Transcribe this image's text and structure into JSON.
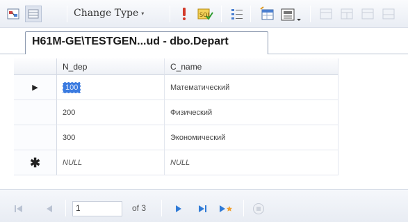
{
  "toolbar": {
    "change_type_label": "Change Type",
    "change_type_arrow": "▾"
  },
  "tab": {
    "title": "H61M-GE\\TESTGEN...ud - dbo.Depart"
  },
  "grid": {
    "columns": [
      "N_dep",
      "C_name"
    ],
    "rows": [
      {
        "marker": "▶",
        "n_dep": "100",
        "c_name": "Математический",
        "selected_cell": "n_dep"
      },
      {
        "marker": "",
        "n_dep": "200",
        "c_name": "Физический"
      },
      {
        "marker": "",
        "n_dep": "300",
        "c_name": "Экономический"
      }
    ],
    "new_row": {
      "marker": "✱",
      "n_dep": "NULL",
      "c_name": "NULL"
    }
  },
  "nav": {
    "current_record": "1",
    "of_label": "of 3"
  },
  "colors": {
    "selection": "#3b7be0",
    "nav_blue": "#2f7ad6",
    "nav_orange": "#f0a030",
    "warn_red": "#d23a2a"
  }
}
